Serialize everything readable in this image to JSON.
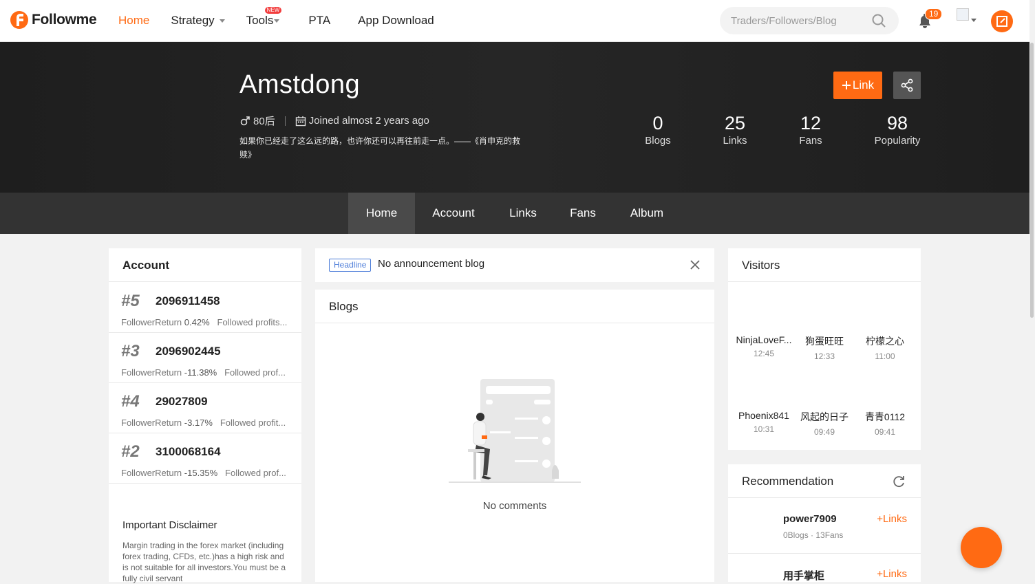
{
  "header": {
    "logo_text": "Followme",
    "nav": [
      {
        "label": "Home",
        "active": true
      },
      {
        "label": "Strategy",
        "dropdown": true
      },
      {
        "label": "Tools",
        "dropdown": true,
        "badge": "NEW"
      },
      {
        "label": "PTA"
      },
      {
        "label": "App Download"
      }
    ],
    "search_placeholder": "Traders/Followers/Blog",
    "notification_count": "19",
    "accent_color": "#ff6a13"
  },
  "profile": {
    "name": "Amstdong",
    "gender_age": "80后",
    "joined": "Joined almost 2 years ago",
    "bio": "如果你已经走了这么远的路，也许你还可以再往前走一点。——《肖申克的救赎》",
    "link_button": "Link",
    "stats": [
      {
        "value": "0",
        "label": "Blogs"
      },
      {
        "value": "25",
        "label": "Links"
      },
      {
        "value": "12",
        "label": "Fans"
      },
      {
        "value": "98",
        "label": "Popularity"
      }
    ]
  },
  "tabs": [
    {
      "label": "Home",
      "active": true
    },
    {
      "label": "Account"
    },
    {
      "label": "Links"
    },
    {
      "label": "Fans"
    },
    {
      "label": "Album"
    }
  ],
  "account_panel": {
    "title": "Account",
    "accounts": [
      {
        "rank": "#5",
        "number": "2096911458",
        "role": "Follower",
        "return_label": "Return",
        "return_value": "0.42%",
        "extra": "Followed profits..."
      },
      {
        "rank": "#3",
        "number": "2096902445",
        "role": "Follower",
        "return_label": "Return",
        "return_value": "-11.38%",
        "extra": "Followed prof..."
      },
      {
        "rank": "#4",
        "number": "29027809",
        "role": "Follower",
        "return_label": "Return",
        "return_value": "-3.17%",
        "extra": "Followed profit..."
      },
      {
        "rank": "#2",
        "number": "3100068164",
        "role": "Follower",
        "return_label": "Return",
        "return_value": "-15.35%",
        "extra": "Followed prof..."
      }
    ],
    "disclaimer_title": "Important Disclaimer",
    "disclaimer_text": "Margin trading in the forex market (including forex trading, CFDs, etc.)has a high risk and is not suitable for all investors.You must be a fully civil servant"
  },
  "announcement": {
    "badge": "Headline",
    "text": "No announcement blog"
  },
  "blogs": {
    "title": "Blogs",
    "empty_text": "No comments"
  },
  "visitors": {
    "title": "Visitors",
    "items": [
      {
        "name": "NinjaLoveF...",
        "time": "12:45"
      },
      {
        "name": "狗蛋旺旺",
        "time": "12:33"
      },
      {
        "name": "柠檬之心",
        "time": "11:00"
      },
      {
        "name": "Phoenix841",
        "time": "10:31"
      },
      {
        "name": "风起的日子",
        "time": "09:49"
      },
      {
        "name": "青青0112",
        "time": "09:41"
      }
    ]
  },
  "recommendation": {
    "title": "Recommendation",
    "items": [
      {
        "name": "power7909",
        "sub": "0Blogs · 13Fans",
        "action": "Links"
      },
      {
        "name": "用手掌柜",
        "sub": "",
        "action": "Links"
      }
    ]
  }
}
